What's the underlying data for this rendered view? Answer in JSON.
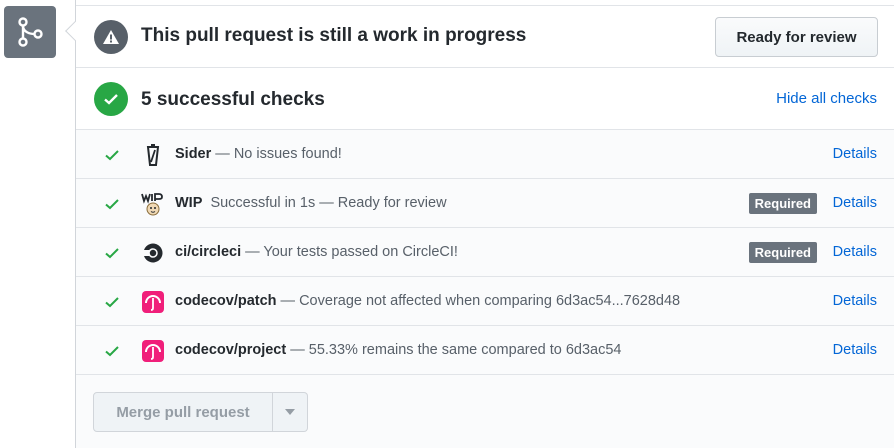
{
  "wip": {
    "title": "This pull request is still a work in progress",
    "ready_button": "Ready for review"
  },
  "summary": {
    "title": "5 successful checks",
    "hide_link": "Hide all checks"
  },
  "checks": [
    {
      "name": "Sider",
      "description": " — No issues found!",
      "required": "",
      "details": "Details",
      "icon": "sider-icon"
    },
    {
      "name": "WIP",
      "description": "  Successful in 1s — Ready for review",
      "required": "Required",
      "details": "Details",
      "icon": "wip-icon"
    },
    {
      "name": "ci/circleci",
      "description": " — Your tests passed on CircleCI!",
      "required": "Required",
      "details": "Details",
      "icon": "circleci-icon"
    },
    {
      "name": "codecov/patch",
      "description": " — Coverage not affected when comparing 6d3ac54...7628d48",
      "required": "",
      "details": "Details",
      "icon": "codecov-icon"
    },
    {
      "name": "codecov/project",
      "description": " — 55.33% remains the same compared to 6d3ac54",
      "required": "",
      "details": "Details",
      "icon": "codecov-icon"
    }
  ],
  "merge": {
    "button_label": "Merge pull request"
  },
  "colors": {
    "success": "#28a745",
    "link": "#0366d6",
    "codecov": "#f01f7a"
  }
}
